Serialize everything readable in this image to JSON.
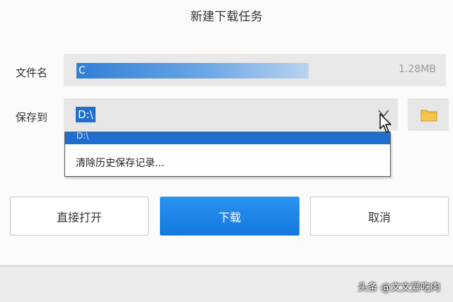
{
  "dialog": {
    "title": "新建下载任务",
    "file_name_label": "文件名",
    "file_name_value": "C",
    "file_size": "1.28MB",
    "save_label": "保存到",
    "save_value": "D:\\",
    "dropdown": {
      "highlighted": "D:\\",
      "clear_history": "清除历史保存记录..."
    },
    "buttons": {
      "open": "直接打开",
      "download": "下载",
      "cancel": "取消"
    }
  },
  "watermark": "头条 @文文爱吃肉",
  "colors": {
    "accent": "#1f6fd0",
    "download_button": "#1a84e8",
    "folder_icon": "#f3c74a"
  },
  "icons": {
    "dropdown": "chevron-down-icon",
    "browse": "folder-icon",
    "pointer": "mouse-cursor-icon"
  }
}
